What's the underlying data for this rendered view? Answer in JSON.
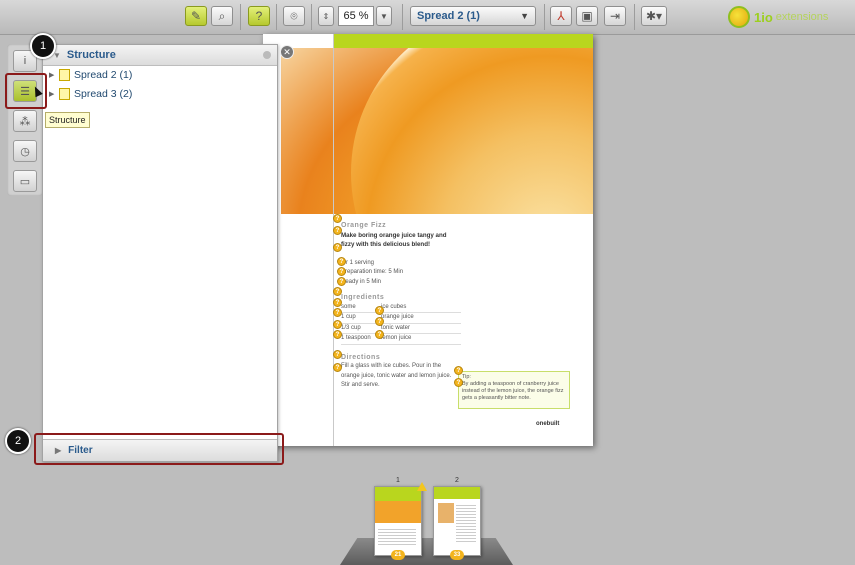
{
  "toolbar": {
    "zoom_value": "65 %",
    "page_select_value": "Spread 2 (1)",
    "icons": [
      "pencil-icon",
      "magnifier-icon",
      "help-icon",
      "binoculars-icon",
      "zoom-stepper-icon",
      "pdf-icon",
      "save-icon",
      "export-icon",
      "bug-icon"
    ]
  },
  "logo": {
    "text": "1io",
    "subtext": "extensions"
  },
  "sidebar": {
    "buttons": [
      "info-icon",
      "structure-icon",
      "flow-icon",
      "history-icon",
      "comments-icon"
    ],
    "tooltip": "Structure"
  },
  "panel": {
    "title": "Structure",
    "items": [
      {
        "label": "Spread 2 (1)"
      },
      {
        "label": "Spread 3 (2)"
      }
    ],
    "filter_label": "Filter"
  },
  "callouts": {
    "one": "1",
    "two": "2"
  },
  "recipe": {
    "title": "Orange Fizz",
    "lead": "Make boring orange juice tangy and fizzy with this delicious blend!",
    "meta": [
      "for 1 serving",
      "Preparation time: 5 Min",
      "Ready in 5 Min"
    ],
    "ingredients_title": "Ingredients",
    "ingredients": [
      {
        "qty": "some",
        "item": "ice cubes"
      },
      {
        "qty": "1 cup",
        "item": "orange juice"
      },
      {
        "qty": "1/3 cup",
        "item": "tonic water"
      },
      {
        "qty": "1 teaspoon",
        "item": "lemon juice"
      }
    ],
    "directions_title": "Directions",
    "directions": "Fill a glass with ice cubes. Pour in the orange juice, tonic water and lemon juice. Stir and serve.",
    "tip_title": "Tip:",
    "tip_text": "By adding a teaspoon of cranberry juice instead of the lemon juice, the orange fizz gets a pleasantly bitter note.",
    "footer": "onebuilt"
  },
  "thumbnails": [
    {
      "number": "1",
      "badge": "21"
    },
    {
      "number": "2",
      "badge": "33"
    }
  ]
}
